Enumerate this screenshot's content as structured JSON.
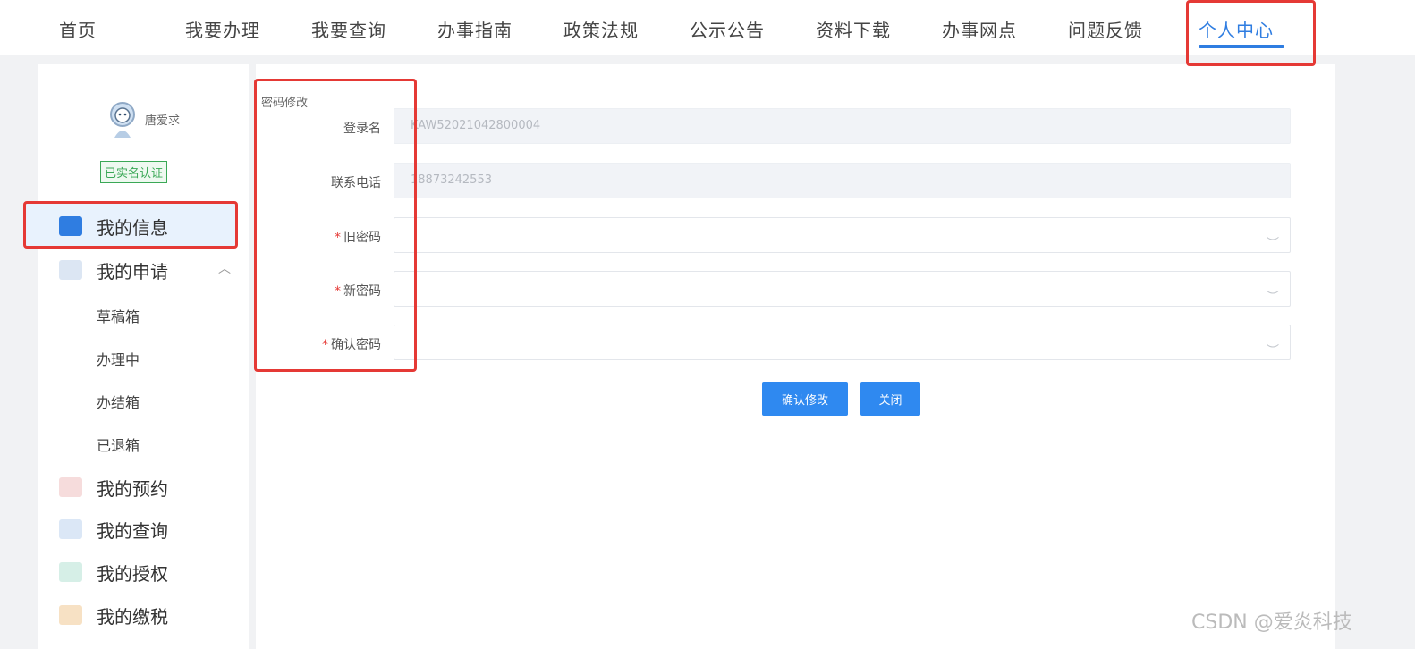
{
  "nav": {
    "items": [
      "首页",
      "我要办理",
      "我要查询",
      "办事指南",
      "政策法规",
      "公示公告",
      "资料下载",
      "办事网点",
      "问题反馈",
      "个人中心"
    ],
    "active_index": 9
  },
  "user": {
    "name": "唐爱求",
    "status": "已实名认证"
  },
  "sidebar": {
    "my_info": "我的信息",
    "my_apply": "我的申请",
    "sub_items": [
      "草稿箱",
      "办理中",
      "办结箱",
      "已退箱"
    ],
    "my_reservation": "我的预约",
    "my_query": "我的查询",
    "my_auth": "我的授权",
    "my_tax": "我的缴税"
  },
  "form": {
    "title": "密码修改",
    "login_label": "登录名",
    "login_value": "KAW52021042800004",
    "phone_label": "联系电话",
    "phone_value": "18873242553",
    "old_pwd_label": "旧密码",
    "new_pwd_label": "新密码",
    "confirm_pwd_label": "确认密码",
    "required_mark": "*"
  },
  "buttons": {
    "confirm": "确认修改",
    "close": "关闭"
  },
  "watermark": "CSDN @爱炎科技",
  "colors": {
    "accent": "#2f7de1",
    "highlight": "#e53935",
    "verified": "#3aa856"
  }
}
